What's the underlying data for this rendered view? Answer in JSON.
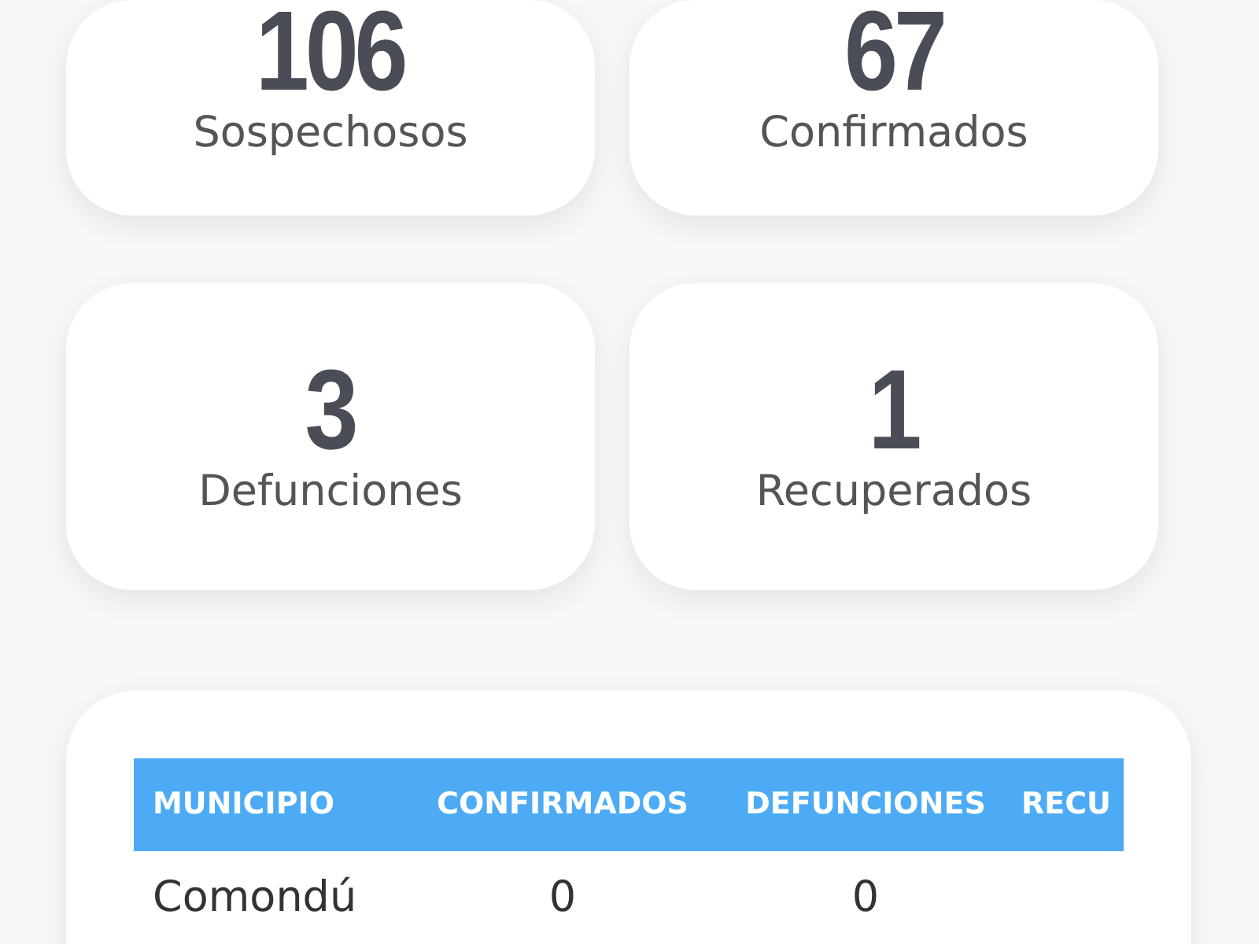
{
  "stats": [
    {
      "value": "106",
      "label": "Sospechosos"
    },
    {
      "value": "67",
      "label": "Confirmados"
    },
    {
      "value": "3",
      "label": "Defunciones"
    },
    {
      "value": "1",
      "label": "Recuperados"
    }
  ],
  "table": {
    "columns": [
      "MUNICIPIO",
      "CONFIRMADOS",
      "DEFUNCIONES",
      "RECU"
    ],
    "rows": [
      [
        "Comondú",
        "0",
        "0"
      ]
    ]
  }
}
